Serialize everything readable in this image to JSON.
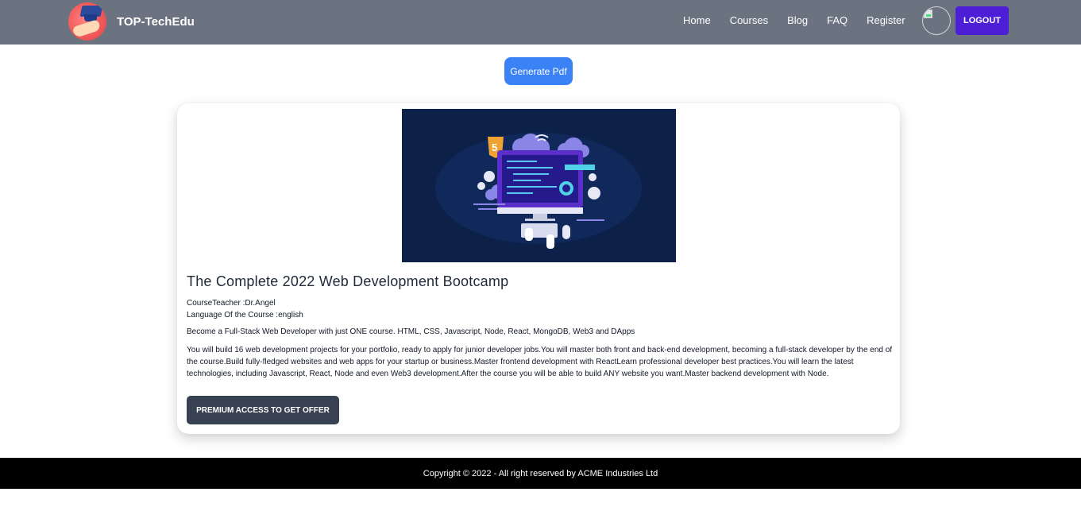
{
  "header": {
    "brand": "TOP-TechEdu",
    "nav": [
      "Home",
      "Courses",
      "Blog",
      "FAQ",
      "Register"
    ],
    "logout_label": "LOGOUT"
  },
  "actions": {
    "generate_pdf_label": "Generate Pdf"
  },
  "course": {
    "title": "The Complete 2022 Web Development Bootcamp",
    "teacher_line": "CourseTeacher :Dr.Angel",
    "language_line": "Language Of the Course :english",
    "short_description": "Become a Full-Stack Web Developer with just ONE course. HTML, CSS, Javascript, Node, React, MongoDB, Web3 and DApps",
    "long_description": "You will build 16 web development projects for your portfolio, ready to apply for junior developer jobs.You will master both front and back-end development, becoming a full-stack developer by the end of the course.Build fully-fledged websites and web apps for your startup or business.Master frontend development with ReactLearn professional developer best practices.You will learn the latest technologies, including Javascript, React, Node and even Web3 development.After the course you will be able to build ANY website you want.Master backend development with Node.",
    "premium_label": "PREMIUM ACCESS TO GET OFFER",
    "image_badge": "5"
  },
  "footer": {
    "copyright": "Copyright © 2022 - All right reserved by ACME Industries Ltd"
  },
  "colors": {
    "navbar": "#6b7280",
    "logout": "#4c1fd6",
    "generate": "#3b82f6",
    "premium": "#374151",
    "footer": "#000000"
  }
}
